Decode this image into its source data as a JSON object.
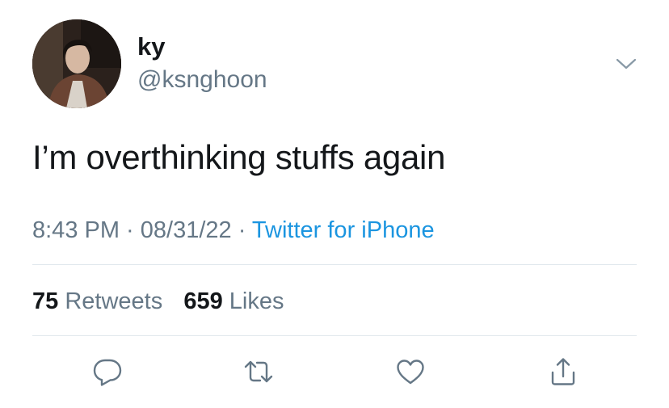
{
  "tweet": {
    "author": {
      "display_name": "ky",
      "handle": "@ksnghoon"
    },
    "text": "I’m overthinking stuffs again",
    "time": "8:43 PM",
    "date": "08/31/22",
    "separator": " · ",
    "source": "Twitter for iPhone",
    "stats": {
      "retweets_count": "75",
      "retweets_label": "Retweets",
      "likes_count": "659",
      "likes_label": "Likes"
    }
  },
  "icons": {
    "menu": "chevron-down-icon",
    "reply": "reply-icon",
    "retweet": "retweet-icon",
    "like": "heart-icon",
    "share": "share-icon"
  },
  "colors": {
    "text": "#14171a",
    "secondary": "#657786",
    "link": "#1b95e0",
    "divider": "#e1e8ed",
    "icon": "#657786"
  }
}
